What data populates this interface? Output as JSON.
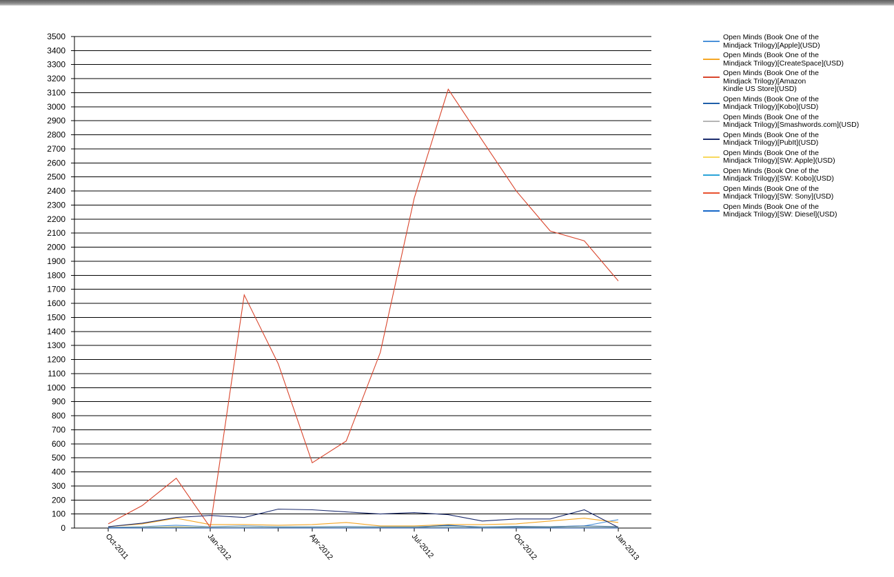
{
  "chart_data": {
    "type": "line",
    "title": "",
    "xlabel": "",
    "ylabel": "",
    "ylim": [
      0,
      3500
    ],
    "y_ticks": [
      0,
      100,
      200,
      300,
      400,
      500,
      600,
      700,
      800,
      900,
      1000,
      1100,
      1200,
      1300,
      1400,
      1500,
      1600,
      1700,
      1800,
      1900,
      2000,
      2100,
      2200,
      2300,
      2400,
      2500,
      2600,
      2700,
      2800,
      2900,
      3000,
      3100,
      3200,
      3300,
      3400,
      3500
    ],
    "x_tick_labels": [
      "Oct-2011",
      "Jan-2012",
      "Apr-2012",
      "Jul-2012",
      "Oct-2012",
      "Jan-2013"
    ],
    "x": [
      "Oct-2011",
      "Nov-2011",
      "Dec-2011",
      "Jan-2012",
      "Feb-2012",
      "Mar-2012",
      "Apr-2012",
      "May-2012",
      "Jun-2012",
      "Jul-2012",
      "Aug-2012",
      "Sep-2012",
      "Oct-2012",
      "Nov-2012",
      "Dec-2012",
      "Jan-2013"
    ],
    "grid": "horizontal",
    "legend_position": "right",
    "series": [
      {
        "name": "Open Minds (Book One of the\nMindjack Trilogy)[Apple](USD)",
        "color": "#4a90d9",
        "values": [
          5,
          10,
          20,
          10,
          15,
          10,
          10,
          12,
          10,
          10,
          15,
          10,
          12,
          10,
          15,
          60
        ]
      },
      {
        "name": "Open Minds (Book One of the\nMindjack Trilogy)[CreateSpace](USD)",
        "color": "#f5a623",
        "values": [
          10,
          30,
          70,
          25,
          25,
          20,
          25,
          40,
          15,
          15,
          25,
          25,
          30,
          50,
          70,
          40
        ]
      },
      {
        "name": "Open Minds (Book One of the\nMindjack Trilogy)[Amazon\nKindle US Store](USD)",
        "color": "#d9442b",
        "values": [
          30,
          160,
          355,
          5,
          1660,
          1170,
          465,
          620,
          1250,
          2350,
          3125,
          2760,
          2400,
          2115,
          2045,
          1760
        ]
      },
      {
        "name": "Open Minds (Book One of the\nMindjack Trilogy)[Kobo](USD)",
        "color": "#1f5fa8",
        "values": [
          5,
          5,
          10,
          5,
          5,
          5,
          5,
          5,
          5,
          5,
          20,
          5,
          10,
          10,
          15,
          10
        ]
      },
      {
        "name": "Open Minds (Book One of the\nMindjack Trilogy)[Smashwords.com](USD)",
        "color": "#b5b5b5",
        "values": [
          2,
          2,
          5,
          2,
          2,
          2,
          2,
          2,
          2,
          2,
          2,
          2,
          2,
          2,
          2,
          2
        ]
      },
      {
        "name": "Open Minds (Book One of the\nMindjack Trilogy)[PubIt](USD)",
        "color": "#1a2a6c",
        "values": [
          10,
          35,
          75,
          90,
          75,
          135,
          130,
          115,
          100,
          110,
          95,
          50,
          65,
          65,
          130,
          5
        ]
      },
      {
        "name": "Open Minds (Book One of the\nMindjack Trilogy)[SW: Apple](USD)",
        "color": "#f7d85c",
        "values": [
          3,
          5,
          8,
          5,
          5,
          5,
          5,
          5,
          5,
          5,
          5,
          5,
          5,
          5,
          5,
          5
        ]
      },
      {
        "name": "Open Minds (Book One of the\nMindjack Trilogy)[SW: Kobo](USD)",
        "color": "#29a3d8",
        "values": [
          2,
          2,
          2,
          2,
          2,
          2,
          2,
          2,
          2,
          2,
          2,
          2,
          2,
          2,
          2,
          2
        ]
      },
      {
        "name": "Open Minds (Book One of the\nMindjack Trilogy)[SW: Sony](USD)",
        "color": "#e8502e",
        "values": [
          1,
          1,
          1,
          1,
          1,
          1,
          1,
          1,
          1,
          1,
          1,
          1,
          1,
          1,
          1,
          1
        ]
      },
      {
        "name": "Open Minds (Book One of the\nMindjack Trilogy)[SW: Diesel](USD)",
        "color": "#1466c8",
        "values": [
          1,
          1,
          1,
          1,
          1,
          1,
          1,
          1,
          1,
          1,
          1,
          1,
          1,
          1,
          1,
          1
        ]
      }
    ]
  }
}
